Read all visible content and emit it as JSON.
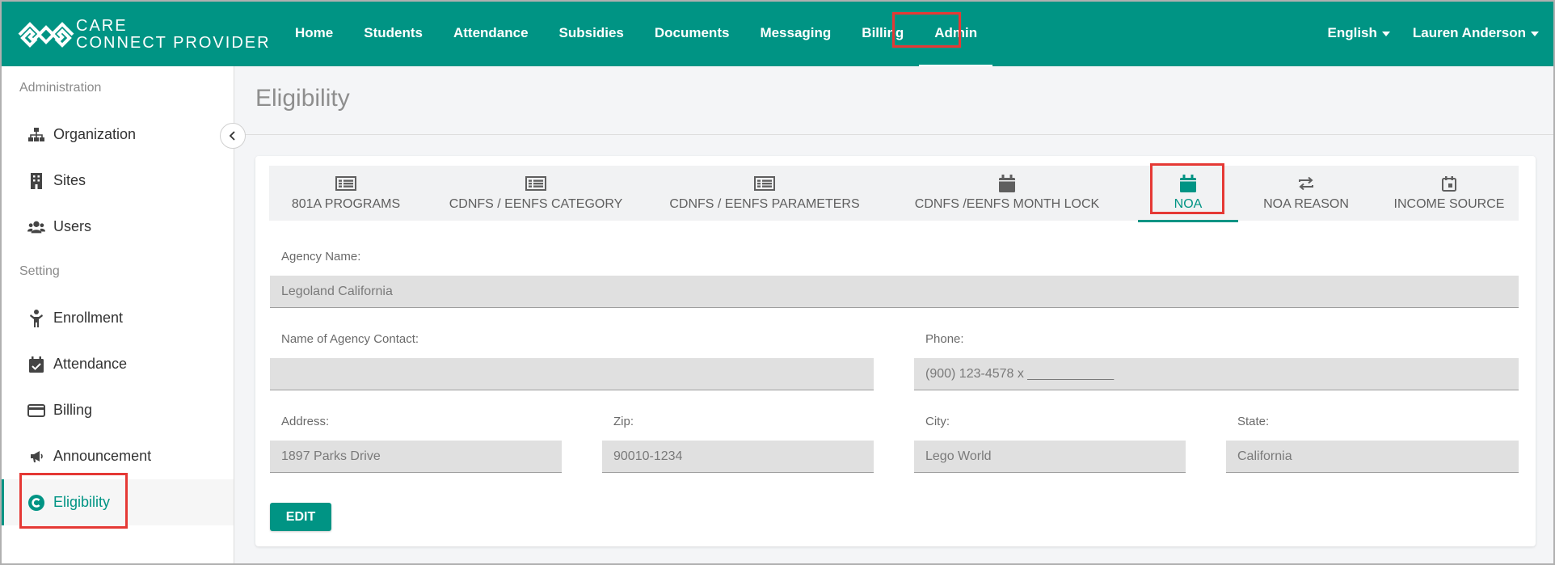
{
  "brand": {
    "line1": "CARE",
    "line2": "CONNECT PROVIDER"
  },
  "nav": {
    "items": [
      {
        "label": "Home"
      },
      {
        "label": "Students"
      },
      {
        "label": "Attendance"
      },
      {
        "label": "Subsidies"
      },
      {
        "label": "Documents"
      },
      {
        "label": "Messaging"
      },
      {
        "label": "Billing"
      },
      {
        "label": "Admin",
        "active": true
      }
    ],
    "language": "English",
    "user": "Lauren Anderson"
  },
  "sidebar": {
    "sections": [
      {
        "title": "Administration",
        "items": [
          {
            "label": "Organization",
            "icon": "sitemap-icon"
          },
          {
            "label": "Sites",
            "icon": "building-icon"
          },
          {
            "label": "Users",
            "icon": "users-icon"
          }
        ]
      },
      {
        "title": "Setting",
        "items": [
          {
            "label": "Enrollment",
            "icon": "child-icon"
          },
          {
            "label": "Attendance",
            "icon": "calendar-check-icon"
          },
          {
            "label": "Billing",
            "icon": "credit-card-icon"
          },
          {
            "label": "Announcement",
            "icon": "megaphone-icon"
          },
          {
            "label": "Eligibility",
            "icon": "eligibility-icon",
            "active": true
          }
        ]
      }
    ]
  },
  "main": {
    "title": "Eligibility",
    "tabs": [
      {
        "label": "801A PROGRAMS",
        "icon": "table-list-icon"
      },
      {
        "label": "CDNFS / EENFS CATEGORY",
        "icon": "table-list-icon"
      },
      {
        "label": "CDNFS / EENFS PARAMETERS",
        "icon": "table-list-icon"
      },
      {
        "label": "CDNFS /EENFS MONTH LOCK",
        "icon": "calendar-icon"
      },
      {
        "label": "NOA",
        "icon": "calendar-icon",
        "active": true
      },
      {
        "label": "NOA REASON",
        "icon": "repeat-icon"
      },
      {
        "label": "INCOME SOURCE",
        "icon": "calendar-small-icon"
      }
    ],
    "form": {
      "agency_name": {
        "label": "Agency Name:",
        "value": "Legoland California"
      },
      "agency_contact": {
        "label": "Name of Agency Contact:",
        "value": ""
      },
      "phone": {
        "label": "Phone:",
        "value": "(900) 123-4578 x ____________"
      },
      "address": {
        "label": "Address:",
        "value": "1897 Parks Drive"
      },
      "zip": {
        "label": "Zip:",
        "value": "90010-1234"
      },
      "city": {
        "label": "City:",
        "value": "Lego World"
      },
      "state": {
        "label": "State:",
        "value": "California"
      }
    },
    "edit_label": "EDIT"
  },
  "colors": {
    "primary": "#009484",
    "highlight": "#e53935"
  }
}
